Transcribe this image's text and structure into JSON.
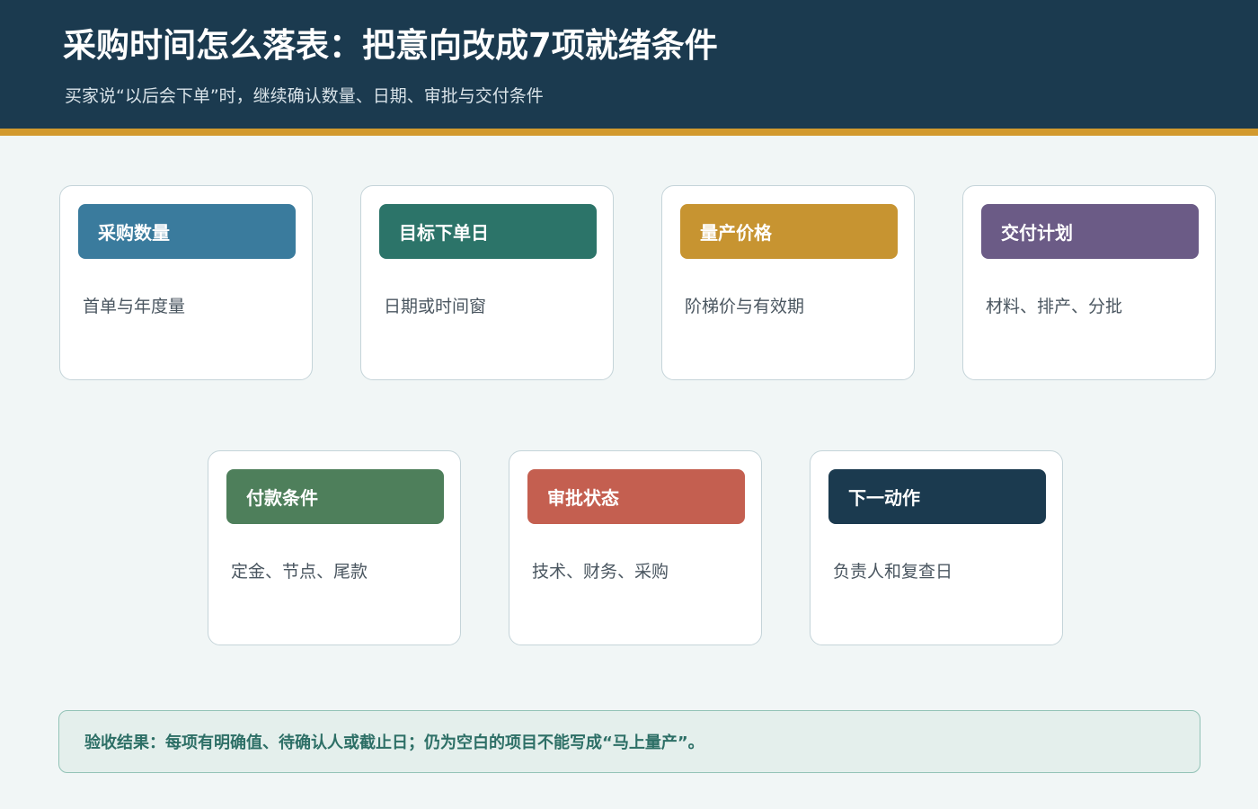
{
  "header": {
    "title": "采购时间怎么落表：把意向改成7项就绪条件",
    "subtitle": "买家说“以后会下单”时，继续确认数量、日期、审批与交付条件"
  },
  "cards": [
    {
      "title": "采购数量",
      "body": "首单与年度量",
      "color": "#3a7b9d"
    },
    {
      "title": "目标下单日",
      "body": "日期或时间窗",
      "color": "#2c7469"
    },
    {
      "title": "量产价格",
      "body": "阶梯价与有效期",
      "color": "#c79431"
    },
    {
      "title": "交付计划",
      "body": "材料、排产、分批",
      "color": "#6b5b86"
    },
    {
      "title": "付款条件",
      "body": "定金、节点、尾款",
      "color": "#4e7f5b"
    },
    {
      "title": "审批状态",
      "body": "技术、财务、采购",
      "color": "#c45f50"
    },
    {
      "title": "下一动作",
      "body": "负责人和复查日",
      "color": "#1b3a4f"
    }
  ],
  "footer": {
    "text": "验收结果：每项有明确值、待确认人或截止日；仍为空白的项目不能写成“马上量产”。"
  }
}
